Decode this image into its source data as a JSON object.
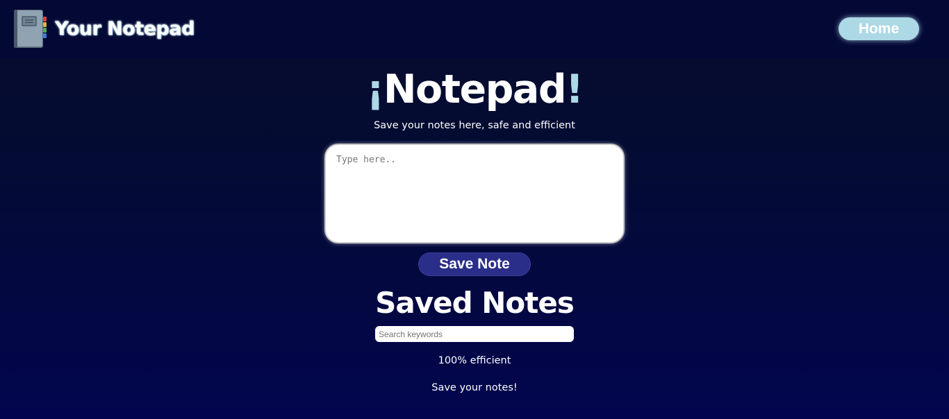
{
  "header": {
    "brand_title": "Your Notepad",
    "brand_icon": "notebook-icon",
    "home_label": "Home"
  },
  "hero": {
    "title_open": "¡",
    "title_word": "Notepad",
    "title_close": "!",
    "subtitle": "Save your notes here, safe and efficient"
  },
  "editor": {
    "placeholder": "Type here..",
    "value": "",
    "save_label": "Save Note"
  },
  "saved": {
    "title": "Saved Notes",
    "search_placeholder": "Search keywords",
    "notes": [
      "100% efficient",
      "Save your notes!"
    ]
  },
  "colors": {
    "background_top": "#060d2c",
    "background_bottom": "#02054e",
    "header_bar": "#040835",
    "accent_light_blue": "#add8e6",
    "save_button": "#2a2e88"
  }
}
